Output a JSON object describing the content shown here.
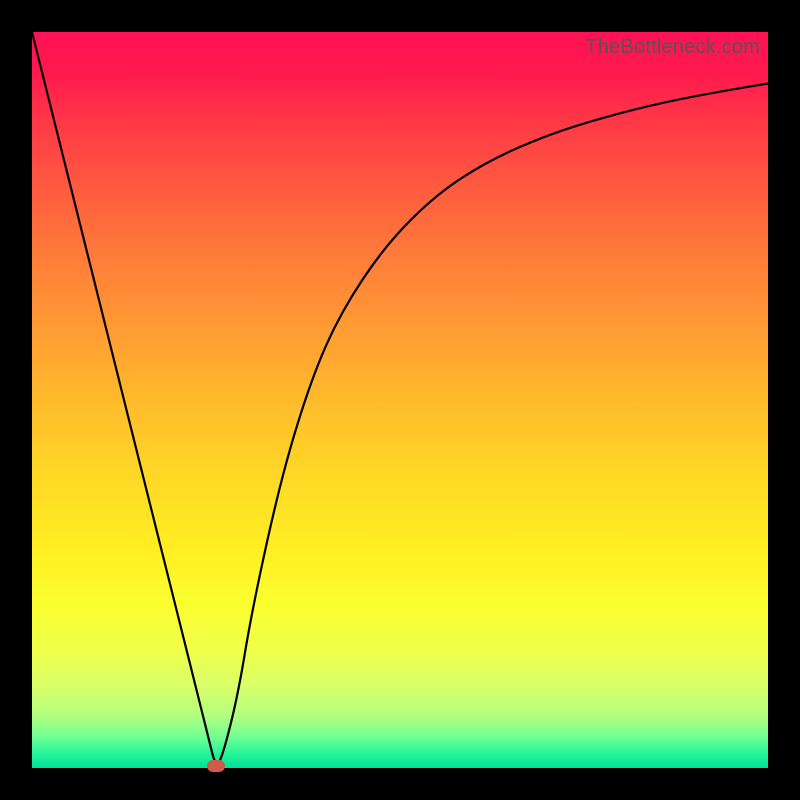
{
  "attribution": "TheBottleneck.com",
  "colors": {
    "frame_bg": "#000000",
    "curve": "#000000",
    "marker": "#cf5b4b",
    "gradient_top": "#ff1155",
    "gradient_bottom": "#00e296"
  },
  "chart_data": {
    "type": "line",
    "title": "",
    "xlabel": "",
    "ylabel": "",
    "xlim": [
      0,
      100
    ],
    "ylim": [
      0,
      100
    ],
    "grid": false,
    "legend": false,
    "series": [
      {
        "name": "bottleneck-curve",
        "x": [
          0,
          5,
          10,
          15,
          20,
          22,
          24,
          25,
          26,
          28,
          30,
          34,
          38,
          42,
          48,
          55,
          62,
          70,
          78,
          86,
          94,
          100
        ],
        "y": [
          100,
          80,
          60,
          40,
          20,
          12,
          4,
          0,
          2,
          10,
          22,
          40,
          53,
          62,
          71,
          78,
          82.5,
          86,
          88.5,
          90.5,
          92,
          93
        ]
      }
    ],
    "annotations": [
      {
        "name": "min-marker",
        "x": 25,
        "y": 0
      }
    ],
    "notes": "Values are approximate percentages read from a gradient plot with a V-shaped curve whose minimum is near x≈25%."
  }
}
